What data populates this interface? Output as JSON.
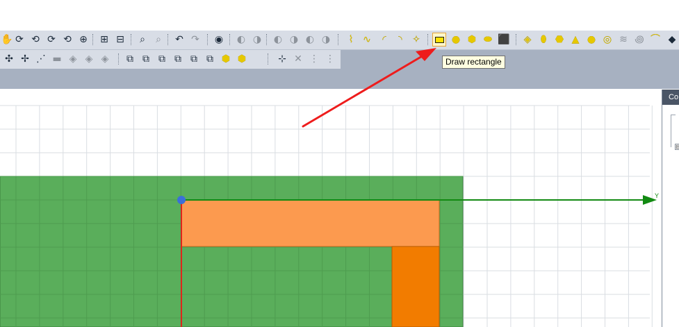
{
  "toolbar": {
    "row1_icons": [
      {
        "name": "pan-hand-icon",
        "glyph": "✋",
        "style": ""
      },
      {
        "name": "rotate-view-1-icon",
        "glyph": "⟳",
        "style": ""
      },
      {
        "name": "rotate-view-2-icon",
        "glyph": "⟲",
        "style": ""
      },
      {
        "name": "rotate-view-3-icon",
        "glyph": "⟳",
        "style": ""
      },
      {
        "name": "rotate-view-4-icon",
        "glyph": "⟲",
        "style": ""
      },
      {
        "name": "zoom-extents-icon",
        "glyph": "⊕",
        "style": ""
      },
      {
        "name": "zoom-window-icon",
        "glyph": "⊞",
        "style": ""
      },
      {
        "name": "zoom-out-box-icon",
        "glyph": "⊟",
        "style": ""
      },
      {
        "name": "zoom-icon",
        "glyph": "⌕",
        "style": ""
      },
      {
        "name": "zoom-previous-icon",
        "glyph": "⌕",
        "style": "gray"
      },
      {
        "name": "undo-view-icon",
        "glyph": "↶",
        "style": ""
      },
      {
        "name": "redo-view-icon",
        "glyph": "↷",
        "style": "gray"
      },
      {
        "name": "view-eye-icon",
        "glyph": "◉",
        "style": ""
      },
      {
        "name": "render-1-icon",
        "glyph": "◐",
        "style": "gray"
      },
      {
        "name": "render-2-icon",
        "glyph": "◑",
        "style": "gray"
      },
      {
        "name": "render-3-icon",
        "glyph": "◐",
        "style": "gray"
      },
      {
        "name": "render-4-icon",
        "glyph": "◑",
        "style": "gray"
      },
      {
        "name": "render-5-icon",
        "glyph": "◐",
        "style": "gray"
      },
      {
        "name": "render-6-icon",
        "glyph": "◑",
        "style": "gray"
      },
      {
        "name": "draw-line-icon",
        "glyph": "⌇",
        "style": "yellow"
      },
      {
        "name": "draw-spline-icon",
        "glyph": "∿",
        "style": "yellow"
      },
      {
        "name": "draw-arc-icon",
        "glyph": "◜",
        "style": "yellow"
      },
      {
        "name": "draw-arc-2-icon",
        "glyph": "◝",
        "style": "yellow"
      },
      {
        "name": "draw-equation-icon",
        "glyph": "✧",
        "style": "yellow"
      },
      {
        "name": "draw-rectangle-icon",
        "glyph": "",
        "style": "active"
      },
      {
        "name": "draw-circle-icon",
        "glyph": "●",
        "style": "yellow"
      },
      {
        "name": "draw-polygon-icon",
        "glyph": "⬢",
        "style": "yellow"
      },
      {
        "name": "draw-ellipse-icon",
        "glyph": "⬬",
        "style": "yellow"
      },
      {
        "name": "draw-region-icon",
        "glyph": "⬛",
        "style": "yellow"
      },
      {
        "name": "draw-box-icon",
        "glyph": "◈",
        "style": "yellow"
      },
      {
        "name": "draw-cylinder-icon",
        "glyph": "⬮",
        "style": "yellow"
      },
      {
        "name": "draw-regular-polyhedron-icon",
        "glyph": "⬣",
        "style": "yellow"
      },
      {
        "name": "draw-cone-icon",
        "glyph": "▲",
        "style": "yellow"
      },
      {
        "name": "draw-sphere-icon",
        "glyph": "●",
        "style": "yellow"
      },
      {
        "name": "draw-torus-icon",
        "glyph": "◎",
        "style": "yellow"
      },
      {
        "name": "draw-helix-icon",
        "glyph": "≋",
        "style": "gray"
      },
      {
        "name": "draw-spiral-icon",
        "glyph": "꩜",
        "style": "gray"
      },
      {
        "name": "draw-bondwire-icon",
        "glyph": "⌒",
        "style": "yellow"
      },
      {
        "name": "more-tools-icon",
        "glyph": "◆",
        "style": ""
      }
    ],
    "row2_icons": [
      {
        "name": "edit-move-icon",
        "glyph": "✣",
        "style": ""
      },
      {
        "name": "edit-rotate-icon",
        "glyph": "✢",
        "style": ""
      },
      {
        "name": "edit-mirror-icon",
        "glyph": "⋰",
        "style": ""
      },
      {
        "name": "edit-array-icon",
        "glyph": "▬",
        "style": "gray"
      },
      {
        "name": "edit-scale-icon",
        "glyph": "◈",
        "style": "gray"
      },
      {
        "name": "edit-offset-icon",
        "glyph": "◈",
        "style": "gray"
      },
      {
        "name": "edit-sweep-icon",
        "glyph": "◈",
        "style": "gray"
      },
      {
        "name": "boolean-unite-icon",
        "glyph": "⧉",
        "style": ""
      },
      {
        "name": "boolean-subtract-icon",
        "glyph": "⧉",
        "style": ""
      },
      {
        "name": "boolean-intersect-icon",
        "glyph": "⧉",
        "style": ""
      },
      {
        "name": "boolean-split-icon",
        "glyph": "⧉",
        "style": ""
      },
      {
        "name": "boolean-imprint-icon",
        "glyph": "⧉",
        "style": ""
      },
      {
        "name": "boolean-separate-icon",
        "glyph": "⧉",
        "style": ""
      },
      {
        "name": "boolean-sweep-icon",
        "glyph": "⬢",
        "style": "yellow"
      },
      {
        "name": "boolean-thicken-icon",
        "glyph": "⬢",
        "style": "yellow"
      },
      {
        "name": "coordinate-create-icon",
        "glyph": "⊹",
        "style": ""
      },
      {
        "name": "coordinate-delete-icon",
        "glyph": "✕",
        "style": "gray"
      },
      {
        "name": "coordinate-face-icon",
        "glyph": "⋮",
        "style": "gray"
      },
      {
        "name": "coordinate-object-icon",
        "glyph": "⋮",
        "style": "gray"
      }
    ]
  },
  "tooltip": {
    "text": "Draw rectangle"
  },
  "viewport": {
    "axis_y_label": "Y",
    "background_color": "#ffffff",
    "grid_color": "#d9dde2",
    "substrate_color": "#5aae5b",
    "trace_color": "#fc9a4f",
    "stub_color": "#f27c00",
    "axis_x_color": "#e0251b",
    "axis_y_color": "#128a12",
    "origin_color": "#3b6fd8"
  },
  "side_panel": {
    "title": "Co",
    "expander": "⊟"
  },
  "annotation": {
    "arrow_color": "#ee1c1c"
  }
}
